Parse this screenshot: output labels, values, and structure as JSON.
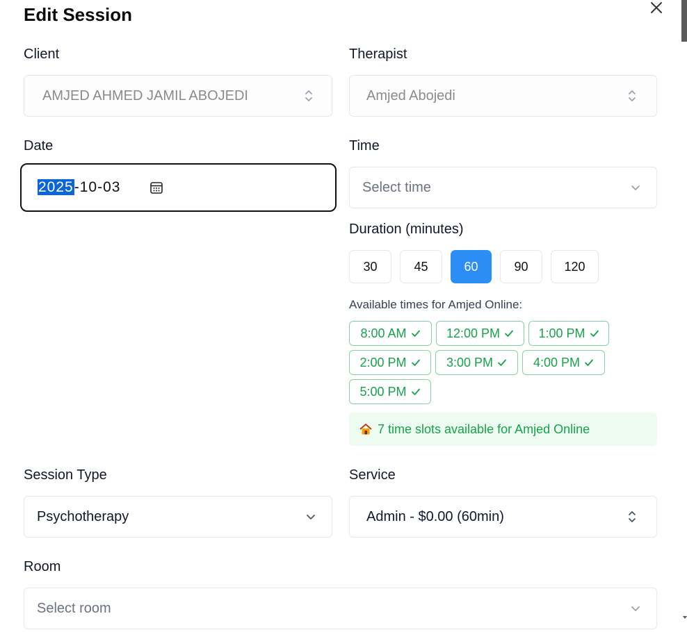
{
  "dialog": {
    "title": "Edit Session"
  },
  "client": {
    "label": "Client",
    "value": "AMJED AHMED JAMIL ABOJEDI"
  },
  "therapist": {
    "label": "Therapist",
    "value": "Amjed Abojedi"
  },
  "date": {
    "label": "Date",
    "year": "2025",
    "rest": "-10-03"
  },
  "time": {
    "label": "Time",
    "placeholder": "Select time"
  },
  "duration": {
    "label": "Duration (minutes)",
    "options": [
      "30",
      "45",
      "60",
      "90",
      "120"
    ],
    "selected": "60"
  },
  "availability": {
    "title": "Available times for Amjed Online:",
    "slots": [
      "8:00 AM",
      "12:00 PM",
      "1:00 PM",
      "2:00 PM",
      "3:00 PM",
      "4:00 PM",
      "5:00 PM"
    ],
    "summary": "7 time slots available for Amjed Online"
  },
  "session_type": {
    "label": "Session Type",
    "value": "Psychotherapy"
  },
  "service": {
    "label": "Service",
    "value": "Admin - $0.00 (60min)"
  },
  "room": {
    "label": "Room",
    "placeholder": "Select room"
  },
  "colors": {
    "accent": "#2c8ef5",
    "success": "#16a34a",
    "success_bg": "#eefbf1",
    "border": "#e5e7eb"
  },
  "icons": {
    "close": "close-icon",
    "updown": "chevron-up-down-icon",
    "chevron": "chevron-down-icon",
    "calendar": "calendar-icon",
    "check": "check-icon",
    "house": "house-icon"
  }
}
